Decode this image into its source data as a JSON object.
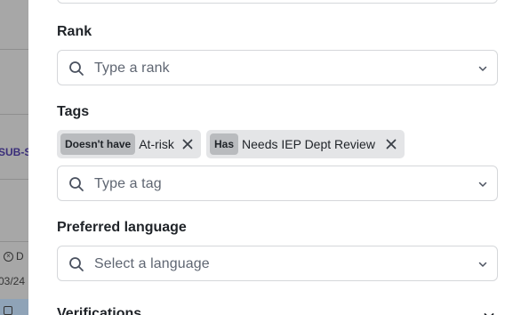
{
  "background": {
    "link_text": "SUB-S",
    "status_text": "D",
    "date_text": "03/24"
  },
  "filters": {
    "rank": {
      "label": "Rank",
      "placeholder": "Type a rank"
    },
    "tags": {
      "label": "Tags",
      "placeholder": "Type a tag",
      "chips": [
        {
          "mode": "Doesn't have",
          "value": "At-risk"
        },
        {
          "mode": "Has",
          "value": "Needs IEP Dept Review"
        }
      ]
    },
    "language": {
      "label": "Preferred language",
      "placeholder": "Select a language"
    },
    "verifications": {
      "label": "Verifications"
    }
  },
  "icons": {
    "search": "search-icon",
    "chevron": "chevron-down-icon",
    "remove": "close-icon"
  },
  "colors": {
    "chip_bg": "#e4e5e7",
    "chip_mode_bg": "#b9bbbe",
    "border": "#d5d7da",
    "placeholder": "#5f6672",
    "overlay": "#9a9a9a"
  }
}
